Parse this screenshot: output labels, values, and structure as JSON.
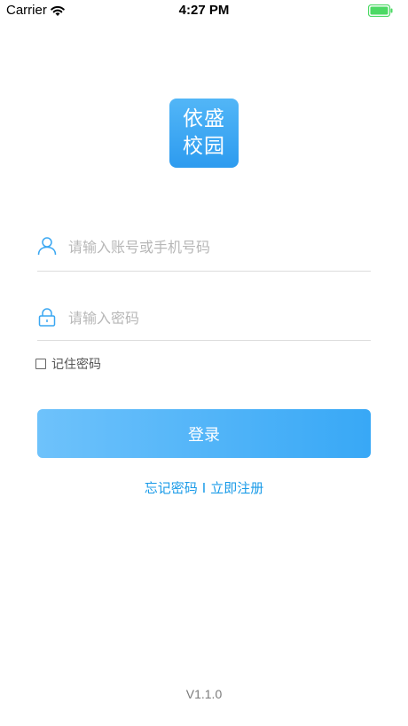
{
  "status_bar": {
    "carrier": "Carrier",
    "time": "4:27 PM",
    "wifi_icon": "wifi-icon",
    "battery_icon": "battery-icon"
  },
  "logo": {
    "line1": "依盛",
    "line2": "校园",
    "color": "#3aa7f2"
  },
  "form": {
    "account_placeholder": "请输入账号或手机号码",
    "password_placeholder": "请输入密码",
    "account_icon": "user-icon",
    "password_icon": "lock-icon",
    "remember_label": "记住密码",
    "login_label": "登录",
    "accent": "#3aa7f2"
  },
  "links": {
    "forgot": "忘记密码",
    "separator": "I",
    "register": "立即注册"
  },
  "version": "V1.1.0"
}
